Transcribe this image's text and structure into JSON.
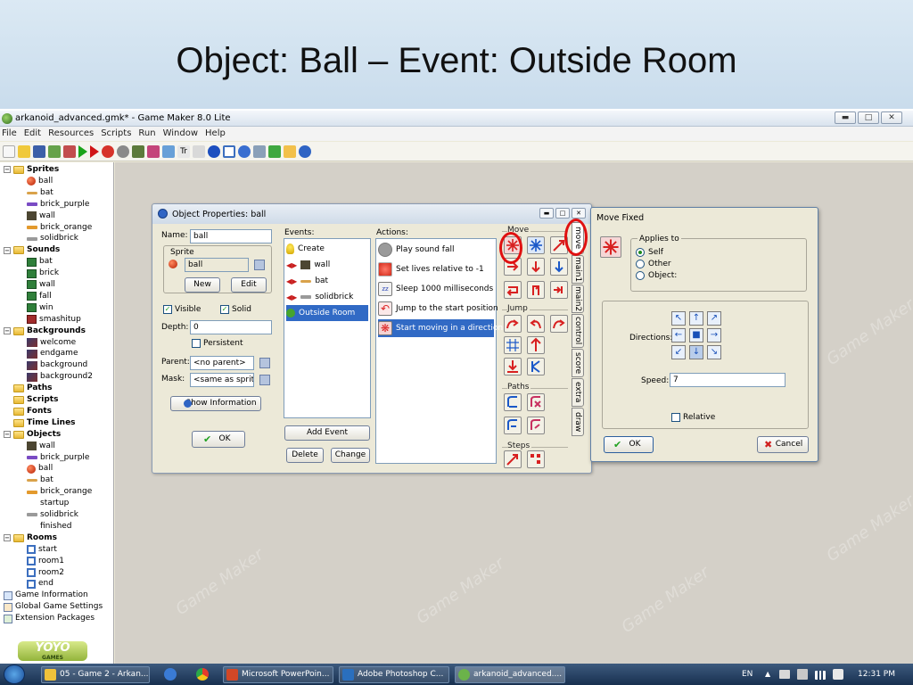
{
  "slide": {
    "title": "Object: Ball – Event: Outside Room"
  },
  "app": {
    "title": "arkanoid_advanced.gmk* - Game Maker 8.0 Lite",
    "menu": [
      "File",
      "Edit",
      "Resources",
      "Scripts",
      "Run",
      "Window",
      "Help"
    ]
  },
  "tree": {
    "sprites": "Sprites",
    "ball": "ball",
    "bat": "bat",
    "brick_purple": "brick_purple",
    "wall": "wall",
    "brick_orange": "brick_orange",
    "solidbrick": "solidbrick",
    "sounds": "Sounds",
    "s_bat": "bat",
    "s_brick": "brick",
    "s_wall": "wall",
    "s_fall": "fall",
    "s_win": "win",
    "s_smashitup": "smashitup",
    "backgrounds": "Backgrounds",
    "welcome": "welcome",
    "endgame": "endgame",
    "background": "background",
    "background2": "background2",
    "paths": "Paths",
    "scripts": "Scripts",
    "fonts": "Fonts",
    "timelines": "Time Lines",
    "objects": "Objects",
    "o_wall": "wall",
    "o_brick_purple": "brick_purple",
    "o_ball": "ball",
    "o_bat": "bat",
    "o_brick_orange": "brick_orange",
    "o_startup": "startup",
    "o_solidbrick": "solidbrick",
    "o_finished": "finished",
    "rooms": "Rooms",
    "r_start": "start",
    "r_room1": "room1",
    "r_room2": "room2",
    "r_end": "end",
    "game_info": "Game Information",
    "global_settings": "Global Game Settings",
    "extensions": "Extension Packages"
  },
  "logo": {
    "text": "YOYO",
    "sub": "GAMES"
  },
  "object_window": {
    "title": "Object Properties: ball",
    "name_label": "Name:",
    "name_value": "ball",
    "sprite_label": "Sprite",
    "sprite_value": "ball",
    "new_button": "New",
    "edit_button": "Edit",
    "visible_label": "Visible",
    "solid_label": "Solid",
    "depth_label": "Depth:",
    "depth_value": "0",
    "persistent_label": "Persistent",
    "parent_label": "Parent:",
    "parent_value": "<no parent>",
    "mask_label": "Mask:",
    "mask_value": "<same as sprite>",
    "show_info_button": "Show Information",
    "ok_button": "OK",
    "events_label": "Events:",
    "events": [
      "Create",
      "wall",
      "bat",
      "solidbrick",
      "Outside Room"
    ],
    "add_event_button": "Add Event",
    "delete_button": "Delete",
    "change_button": "Change",
    "actions_label": "Actions:",
    "actions": [
      "Play sound fall",
      "Set lives relative to -1",
      "Sleep 1000 milliseconds",
      "Jump to the start position",
      "Start moving in a direction"
    ],
    "sections": {
      "move": "Move",
      "jump": "Jump",
      "paths": "Paths",
      "steps": "Steps"
    },
    "tabs": [
      "move",
      "main1",
      "main2",
      "control",
      "score",
      "extra",
      "draw"
    ]
  },
  "move_dialog": {
    "title": "Move Fixed",
    "applies_to_label": "Applies to",
    "options": [
      "Self",
      "Other",
      "Object:"
    ],
    "directions_label": "Directions:",
    "speed_label": "Speed:",
    "speed_value": "7",
    "relative_label": "Relative",
    "ok_button": "OK",
    "cancel_button": "Cancel"
  },
  "watermark_text": "Game Maker",
  "taskbar": {
    "tasks": [
      "05 - Game 2 - Arkan...",
      "Microsoft PowerPoin...",
      "Adobe Photoshop C...",
      "arkanoid_advanced...."
    ],
    "lang": "EN",
    "clock": "12:31 PM"
  },
  "colors": {
    "selection": "#316ac5",
    "highlight_circle": "#e01010",
    "title_band": "#dbe9f4"
  }
}
